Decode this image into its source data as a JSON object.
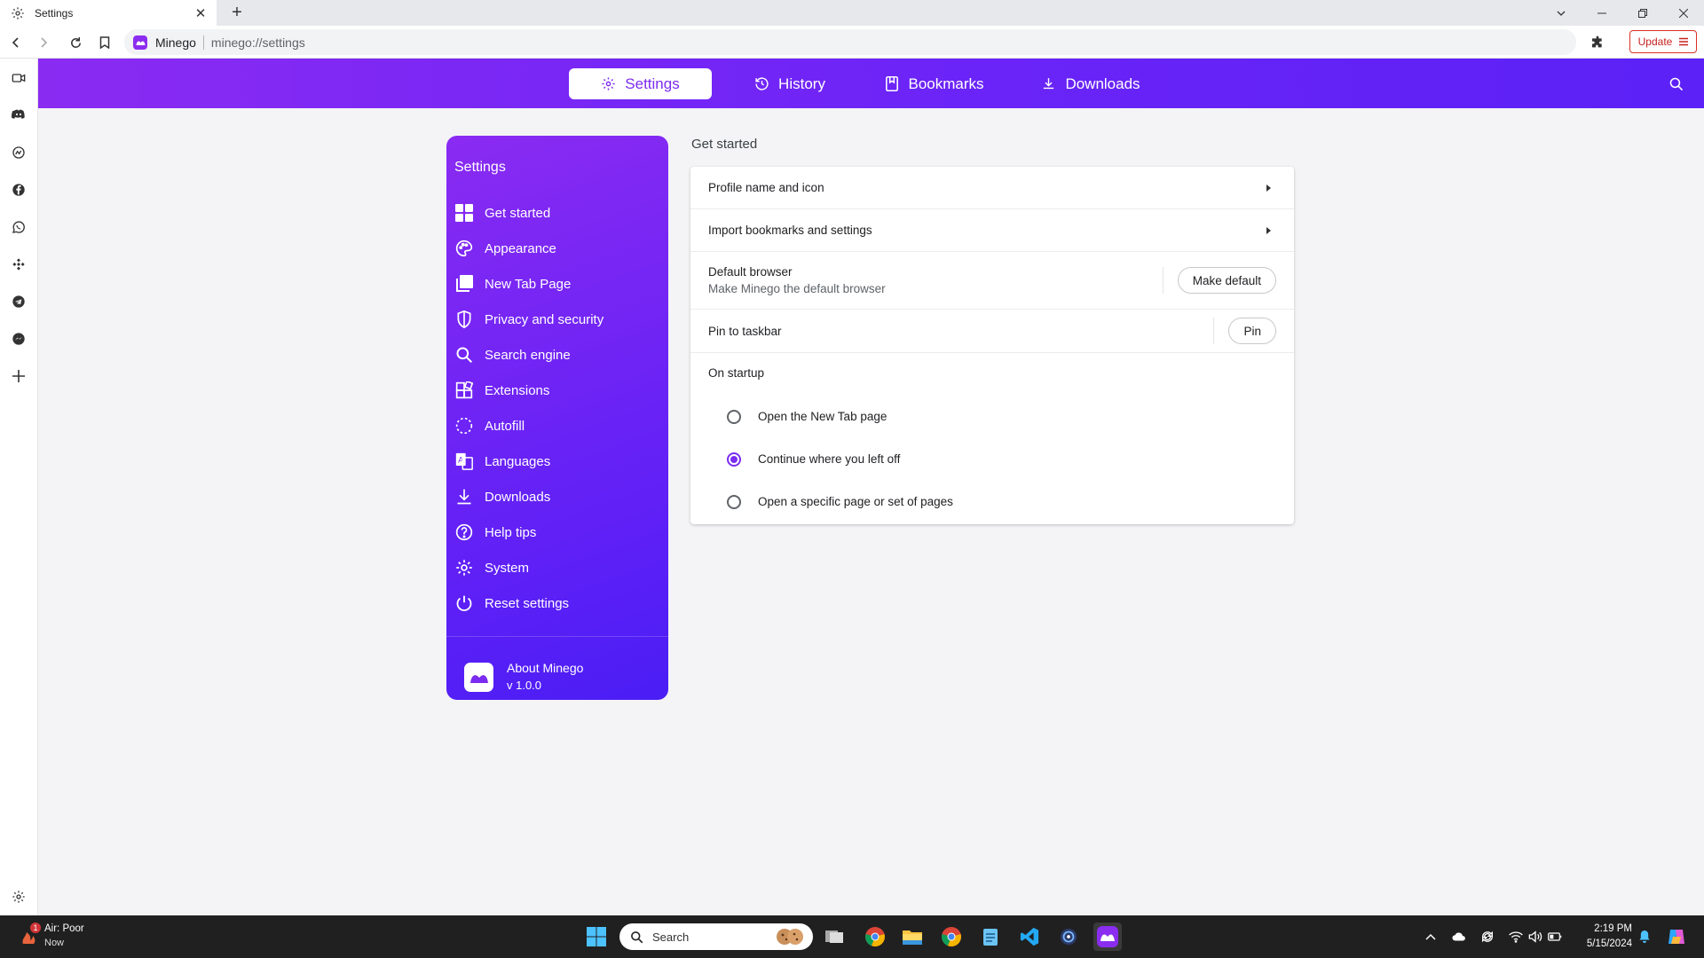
{
  "tab": {
    "title": "Settings",
    "icon": "gear-icon"
  },
  "address": {
    "site": "Minego",
    "url": "minego://settings"
  },
  "update_label": "Update",
  "header_tabs": [
    {
      "label": "Settings",
      "icon": "gear-icon",
      "active": true
    },
    {
      "label": "History",
      "icon": "history-icon",
      "active": false
    },
    {
      "label": "Bookmarks",
      "icon": "bookmark-icon",
      "active": false
    },
    {
      "label": "Downloads",
      "icon": "download-icon",
      "active": false
    }
  ],
  "sidebar": {
    "title": "Settings",
    "items": [
      {
        "label": "Get started",
        "icon": "grid-icon"
      },
      {
        "label": "Appearance",
        "icon": "palette-icon"
      },
      {
        "label": "New Tab Page",
        "icon": "new-tab-icon"
      },
      {
        "label": "Privacy and security",
        "icon": "shield-icon"
      },
      {
        "label": "Search engine",
        "icon": "search-icon"
      },
      {
        "label": "Extensions",
        "icon": "extensions-icon"
      },
      {
        "label": "Autofill",
        "icon": "autofill-icon"
      },
      {
        "label": "Languages",
        "icon": "translate-icon"
      },
      {
        "label": "Downloads",
        "icon": "download-icon"
      },
      {
        "label": "Help tips",
        "icon": "help-icon"
      },
      {
        "label": "System",
        "icon": "gear-icon"
      },
      {
        "label": "Reset settings",
        "icon": "power-icon"
      }
    ],
    "about": {
      "name": "About Minego",
      "version": "v 1.0.0"
    }
  },
  "main": {
    "section_title": "Get started",
    "rows": {
      "profile": "Profile name and icon",
      "import": "Import bookmarks and settings",
      "default_title": "Default browser",
      "default_sub": "Make Minego the default browser",
      "default_button": "Make default",
      "pin_label": "Pin to taskbar",
      "pin_button": "Pin",
      "startup_title": "On startup"
    },
    "startup_options": [
      {
        "label": "Open the New Tab page",
        "selected": false
      },
      {
        "label": "Continue where you left off",
        "selected": true
      },
      {
        "label": "Open a specific page or set of pages",
        "selected": false
      }
    ]
  },
  "taskbar": {
    "weather_title": "Air: Poor",
    "weather_sub": "Now",
    "weather_badge": "1",
    "search_placeholder": "Search",
    "time": "2:19 PM",
    "date": "5/15/2024"
  },
  "colors": {
    "accent": "#7b2cf0",
    "header_start": "#8a2bf2",
    "header_end": "#5b21f6"
  }
}
